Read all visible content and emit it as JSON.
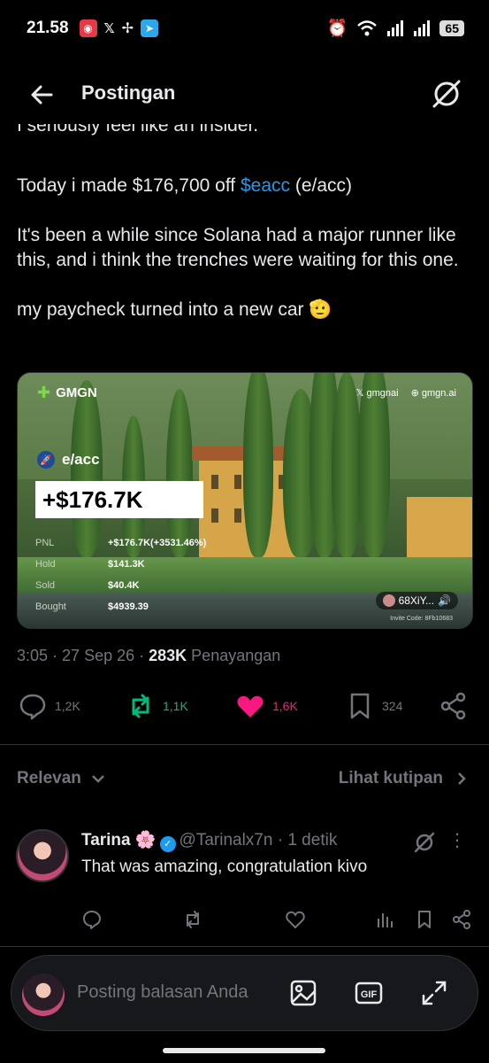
{
  "status_bar": {
    "time": "21.58",
    "battery": "65"
  },
  "header": {
    "title": "Postingan"
  },
  "tweet": {
    "cut_line": "I seriously feel like an insider.",
    "line1_pre": "Today i made $176,700 off ",
    "cashtag": "$eacc",
    "line1_post": " (e/acc)",
    "para2": "It's been a while since Solana had a major runner like this, and i think the trenches were waiting for this one.",
    "para3": "my paycheck turned into a new car 🫡"
  },
  "media": {
    "brand": "GMGN",
    "link_x": "gmgnai",
    "link_web": "gmgn.ai",
    "token": "e/acc",
    "pnl_big": "+$176.7K",
    "stats": [
      {
        "label": "PNL",
        "value": "+$176.7K(+3531.46%)"
      },
      {
        "label": "Hold",
        "value": "$141.3K"
      },
      {
        "label": "Sold",
        "value": "$40.4K"
      },
      {
        "label": "Bought",
        "value": "$4939.39"
      }
    ],
    "user_chip": "68XiY...",
    "invite": "Invite Code: 8Fb10683"
  },
  "meta": {
    "time": "3:05",
    "date": "27 Sep 26",
    "views_count": "283K",
    "views_label": "Penayangan"
  },
  "actions": {
    "replies": "1,2K",
    "reposts": "1,1K",
    "likes": "1,6K",
    "bookmarks": "324"
  },
  "filters": {
    "relevan": "Relevan",
    "lihat_kutipan": "Lihat kutipan"
  },
  "reply": {
    "name": "Tarina 🌸",
    "handle": "@Tarinalx7n",
    "time": "· 1 detik",
    "text": "That was amazing, congratulation kivo"
  },
  "composer": {
    "placeholder": "Posting balasan Anda"
  },
  "colors": {
    "accent": "#1d9bf0",
    "like": "#f91880",
    "repost": "#00ba7c",
    "muted": "#71767b"
  }
}
